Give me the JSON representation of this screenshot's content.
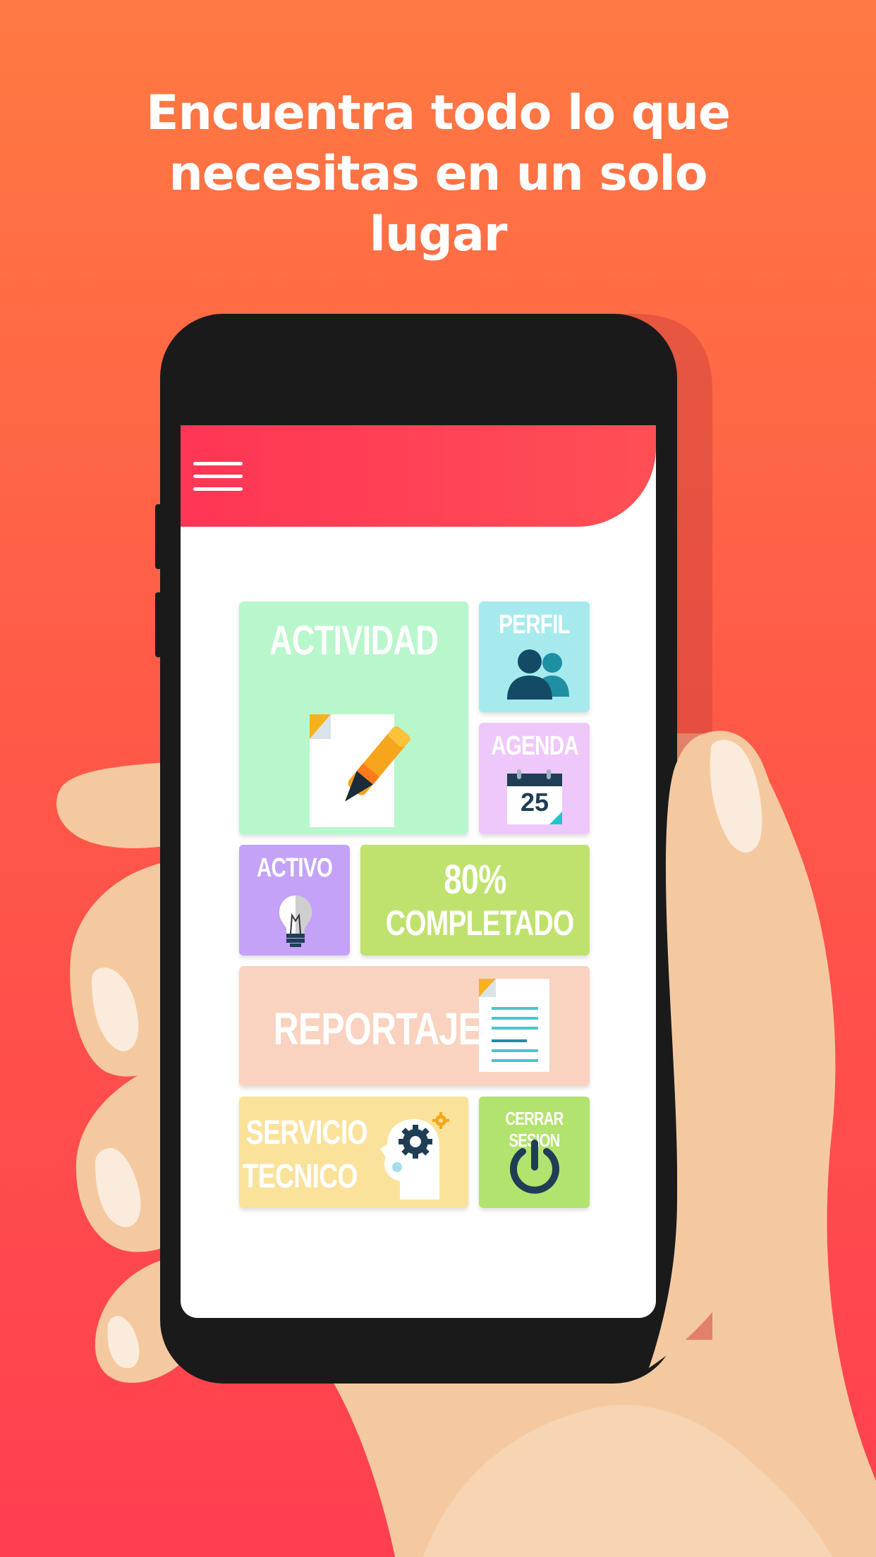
{
  "headline": {
    "line1": "Encuentra todo lo que",
    "line2": "necesitas en un solo",
    "line3": "lugar"
  },
  "colors": {
    "background_top": "#ff7a42",
    "background_bottom": "#ff3f50",
    "appbar": "#ff3a55",
    "phone_body": "#1a1a1a",
    "actividad": "#b8f7cb",
    "perfil": "#a6eaee",
    "agenda": "#eec8fa",
    "activo": "#c3a2f7",
    "completado": "#bfe26e",
    "reportaje": "#f9d3c0",
    "servicio": "#fbe29b",
    "cerrar": "#b2e36e"
  },
  "appbar": {
    "menu_icon": "hamburger-menu-icon"
  },
  "tiles": {
    "actividad": {
      "label": "ACTIVIDAD",
      "icon": "document-pen-icon"
    },
    "perfil": {
      "label": "PERFIL",
      "icon": "users-icon"
    },
    "agenda": {
      "label": "AGENDA",
      "icon": "calendar-icon",
      "date": "25"
    },
    "activo": {
      "label": "ACTIVO",
      "icon": "lightbulb-icon"
    },
    "progreso": {
      "percent_label": "80%",
      "label": "COMPLETADO",
      "value": 80
    },
    "reportaje": {
      "label": "REPORTAJE",
      "icon": "report-document-icon"
    },
    "servicio": {
      "label_line1": "SERVICIO",
      "label_line2": "TECNICO",
      "icon": "head-gears-icon"
    },
    "cerrar": {
      "label": "CERRAR SESION",
      "icon": "power-icon"
    }
  }
}
